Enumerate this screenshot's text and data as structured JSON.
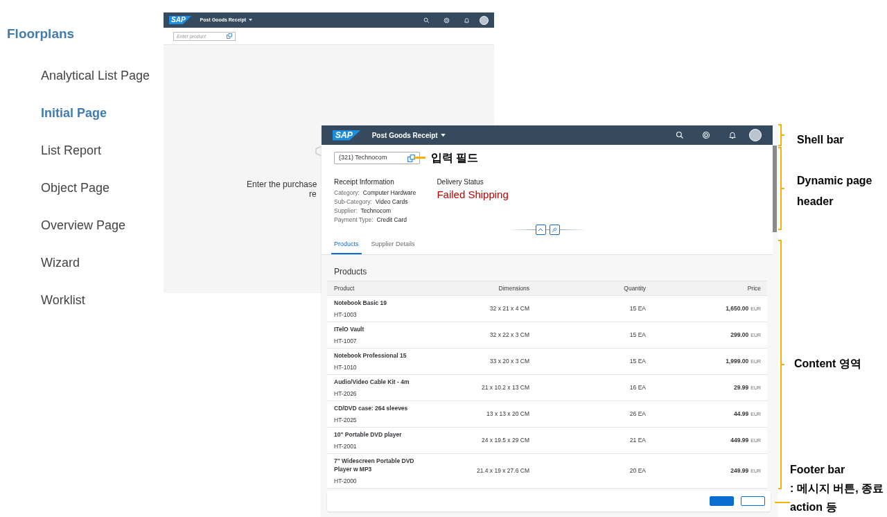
{
  "sidebar": {
    "title": "Floorplans",
    "items": [
      {
        "label": "Analytical List Page",
        "selected": false
      },
      {
        "label": "Initial Page",
        "selected": true
      },
      {
        "label": "List Report",
        "selected": false
      },
      {
        "label": "Object Page",
        "selected": false
      },
      {
        "label": "Overview Page",
        "selected": false
      },
      {
        "label": "Wizard",
        "selected": false
      },
      {
        "label": "Worklist",
        "selected": false
      }
    ]
  },
  "back_screen": {
    "shell_bar": {
      "logo": "SAP",
      "title": "Post Goods Receipt"
    },
    "product_field": {
      "placeholder": "Enter product"
    },
    "message_fragments": [
      "Enter the purchase",
      "re"
    ]
  },
  "front_screen": {
    "shell_bar": {
      "logo": "SAP",
      "title": "Post Goods Receipt"
    },
    "product_field": {
      "value": "(321) Technocom"
    },
    "header": {
      "title": "Receipt Information",
      "fields": [
        {
          "label": "Category:",
          "value": "Computer Hardware"
        },
        {
          "label": "Sub-Category:",
          "value": "Video Cards"
        },
        {
          "label": "Supplier:",
          "value": "Technocom"
        },
        {
          "label": "Payment Type:",
          "value": "Credit Card"
        }
      ],
      "status_label": "Delivery Status",
      "status": "Failed Shipping"
    },
    "tabs": [
      {
        "label": "Products",
        "selected": true
      },
      {
        "label": "Supplier Details",
        "selected": false
      }
    ],
    "table": {
      "title": "Products",
      "columns": [
        "Product",
        "Dimensions",
        "Quantity",
        "Price"
      ],
      "rows": [
        {
          "name": "Notebook Basic 19",
          "id": "HT-1003",
          "dimensions": "32 x 21 x 4 CM",
          "quantity": "15 EA",
          "price": "1,650.00",
          "currency": "EUR"
        },
        {
          "name": "ITelO Vault",
          "id": "HT-1007",
          "dimensions": "32 x 22 x 3 CM",
          "quantity": "15 EA",
          "price": "299.00",
          "currency": "EUR"
        },
        {
          "name": "Notebook Professional 15",
          "id": "HT-1010",
          "dimensions": "33 x 20 x 3 CM",
          "quantity": "15 EA",
          "price": "1,999.00",
          "currency": "EUR"
        },
        {
          "name": "Audio/Video Cable Kit - 4m",
          "id": "HT-2026",
          "dimensions": "21 x 10.2 x 13 CM",
          "quantity": "16 EA",
          "price": "29.99",
          "currency": "EUR"
        },
        {
          "name": "CD/DVD case: 264 sleeves",
          "id": "HT-2025",
          "dimensions": "13 x 13 x 20 CM",
          "quantity": "26 EA",
          "price": "44.99",
          "currency": "EUR"
        },
        {
          "name": "10\" Portable DVD player",
          "id": "HT-2001",
          "dimensions": "24 x 19.5 x 29 CM",
          "quantity": "21 EA",
          "price": "449.99",
          "currency": "EUR"
        },
        {
          "name": "7\" Widescreen Portable DVD Player w MP3",
          "id": "HT-2000",
          "dimensions": "21.4 x 19 x 27.6 CM",
          "quantity": "20 EA",
          "price": "249.99",
          "currency": "EUR"
        }
      ]
    },
    "footer": {
      "buttons": [
        {
          "kind": "emphasized"
        },
        {
          "kind": "default"
        }
      ]
    }
  },
  "annotations": [
    {
      "kind": "pointer",
      "label": "입력 필드"
    },
    {
      "kind": "bracket",
      "label": "Shell bar"
    },
    {
      "kind": "bracket",
      "label": "Dynamic page header"
    },
    {
      "kind": "bracket",
      "label": "Content 영역"
    },
    {
      "kind": "pointer",
      "label": "Footer bar",
      "note": ": 메시지 버튼, 종료 action 등"
    }
  ]
}
